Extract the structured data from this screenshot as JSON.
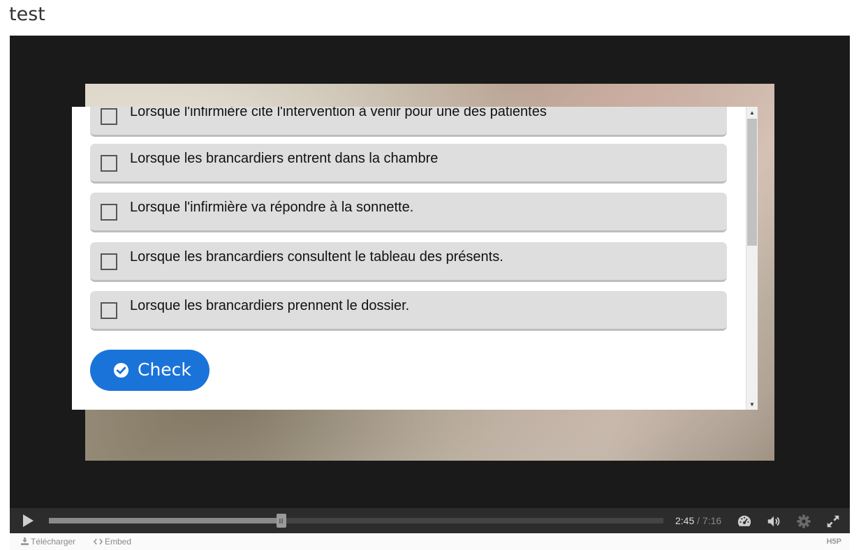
{
  "page": {
    "title": "test"
  },
  "quiz": {
    "options": [
      {
        "label": "Lorsque l'infirmière cite l'intervention à venir pour une des patientes"
      },
      {
        "label": "Lorsque les brancardiers entrent dans la chambre"
      },
      {
        "label": "Lorsque l'infirmière va répondre à la sonnette."
      },
      {
        "label": "Lorsque les brancardiers consultent le tableau des présents."
      },
      {
        "label": "Lorsque les brancardiers prennent le dossier."
      }
    ],
    "check_label": "Check"
  },
  "player": {
    "time_current": "2:45",
    "time_separator": " / ",
    "time_total": "7:16",
    "progress_fraction": 0.378
  },
  "footer": {
    "download_label": "Télécharger",
    "embed_label": "Embed",
    "logo": "H5P"
  },
  "colors": {
    "accent": "#1a73d9",
    "option_bg": "#dedede",
    "player_bg": "#1a1a1a"
  },
  "icons": [
    "check-circle-icon",
    "play-icon",
    "speed-gauge-icon",
    "volume-icon",
    "gear-icon",
    "fullscreen-icon",
    "download-icon",
    "embed-code-icon",
    "scroll-up-icon",
    "scroll-down-icon"
  ]
}
